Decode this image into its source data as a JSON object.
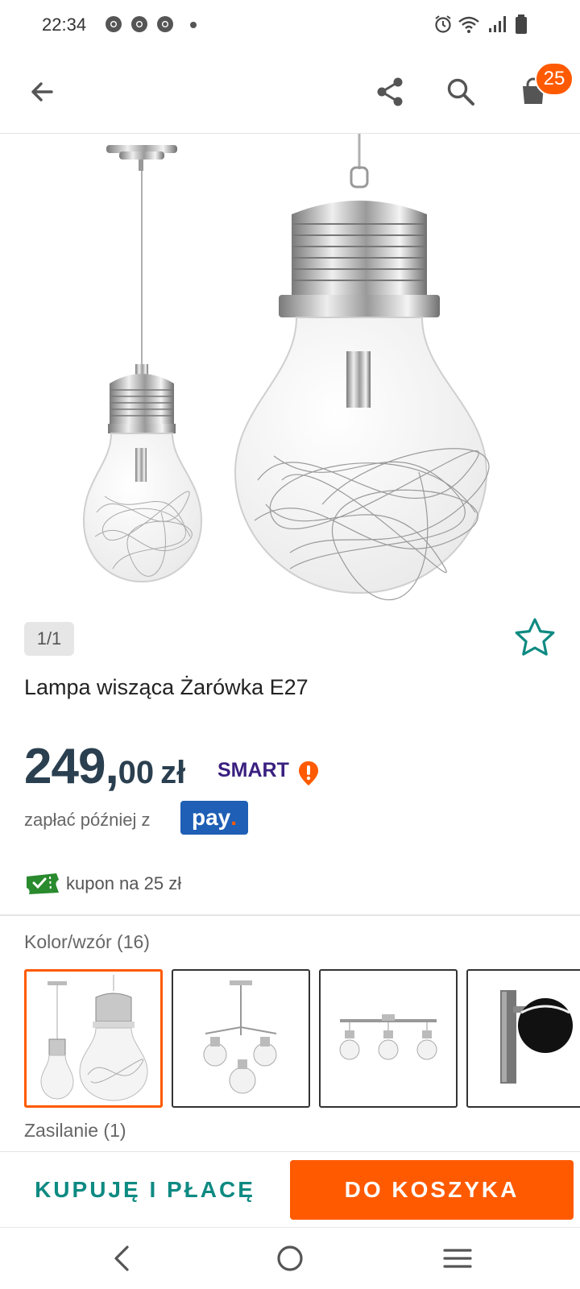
{
  "status_bar": {
    "time": "22:34",
    "notification_icons": [
      "chrome-icon",
      "chrome-icon",
      "chrome-icon"
    ],
    "system_icons": [
      "alarm-icon",
      "wifi-icon",
      "signal-icon",
      "battery-icon"
    ]
  },
  "app_bar": {
    "back_icon": "arrow-back-icon",
    "share_icon": "share-icon",
    "search_icon": "search-icon",
    "cart_icon": "cart-icon",
    "cart_count": "25"
  },
  "product": {
    "image_counter": "1/1",
    "title": "Lampa wisząca Żarówka E27",
    "price_int": "249,",
    "price_dec": "00",
    "currency": "zł",
    "smart_label": "SMART",
    "pay_later_text": "zapłać później z",
    "pay_logo_text": "pay",
    "pay_logo_dot": ".",
    "coupon_text": "kupon na 25 zł"
  },
  "variants": {
    "label": "Kolor/wzór (16)",
    "items": [
      {
        "name": "variant-bulb-pendant",
        "selected": true
      },
      {
        "name": "variant-chandelier",
        "selected": false
      },
      {
        "name": "variant-triple-bar",
        "selected": false
      },
      {
        "name": "variant-wall-spot",
        "selected": false
      }
    ]
  },
  "power": {
    "label": "Zasilanie (1)"
  },
  "actions": {
    "buy_now": "KUPUJĘ I PŁACĘ",
    "add_to_cart": "DO KOSZYKA"
  },
  "colors": {
    "accent_orange": "#ff5a00",
    "teal": "#0e8a82",
    "price_color": "#2a3f4f",
    "pay_blue": "#1f5fb5"
  }
}
